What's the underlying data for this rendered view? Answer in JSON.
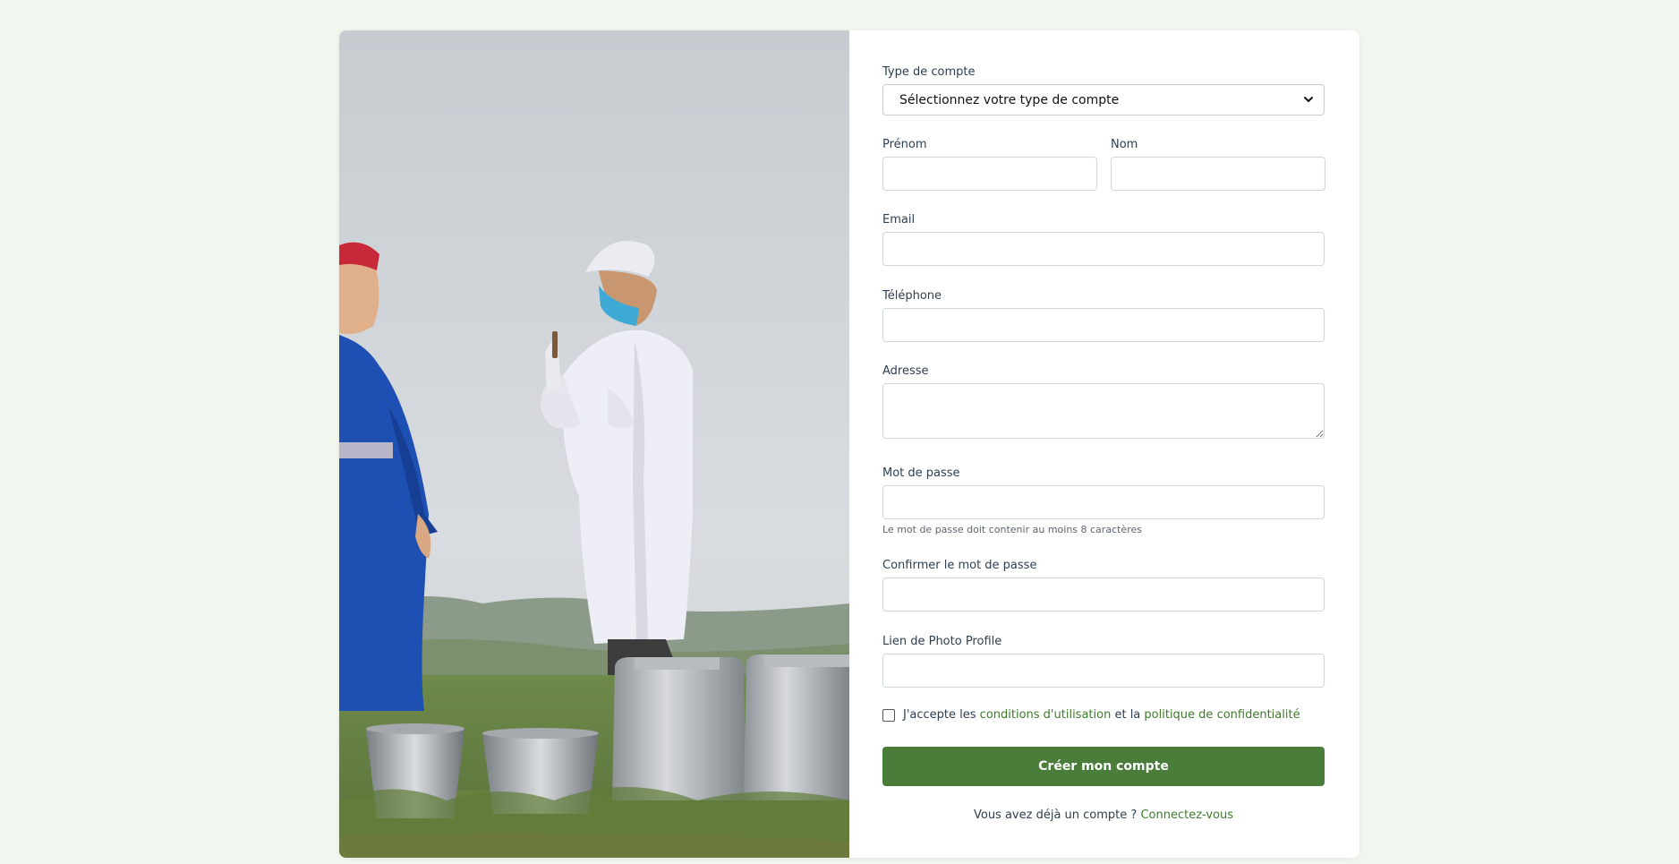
{
  "form": {
    "account_type_label": "Type de compte",
    "account_type_selected": "Sélectionnez votre type de compte",
    "first_name_label": "Prénom",
    "last_name_label": "Nom",
    "email_label": "Email",
    "phone_label": "Téléphone",
    "address_label": "Adresse",
    "password_label": "Mot de passe",
    "password_hint": "Le mot de passe doit contenir au moins 8 caractères",
    "confirm_password_label": "Confirmer le mot de passe",
    "photo_link_label": "Lien de Photo Profile",
    "terms_prefix": "J'accepte les",
    "terms_link": "conditions d'utilisation",
    "terms_middle": "et la",
    "privacy_link": "politique de confidentialité",
    "submit_label": "Créer mon compte",
    "login_prompt": "Vous avez déjà un compte ?",
    "login_link": "Connectez-vous"
  },
  "colors": {
    "page_background": "#f1f7ee",
    "accent_green": "#497d39",
    "link_green": "#3f7a2b"
  },
  "icons": {
    "select_chevron": "chevron-down-icon",
    "textarea_resize": "resize-grip-icon"
  }
}
